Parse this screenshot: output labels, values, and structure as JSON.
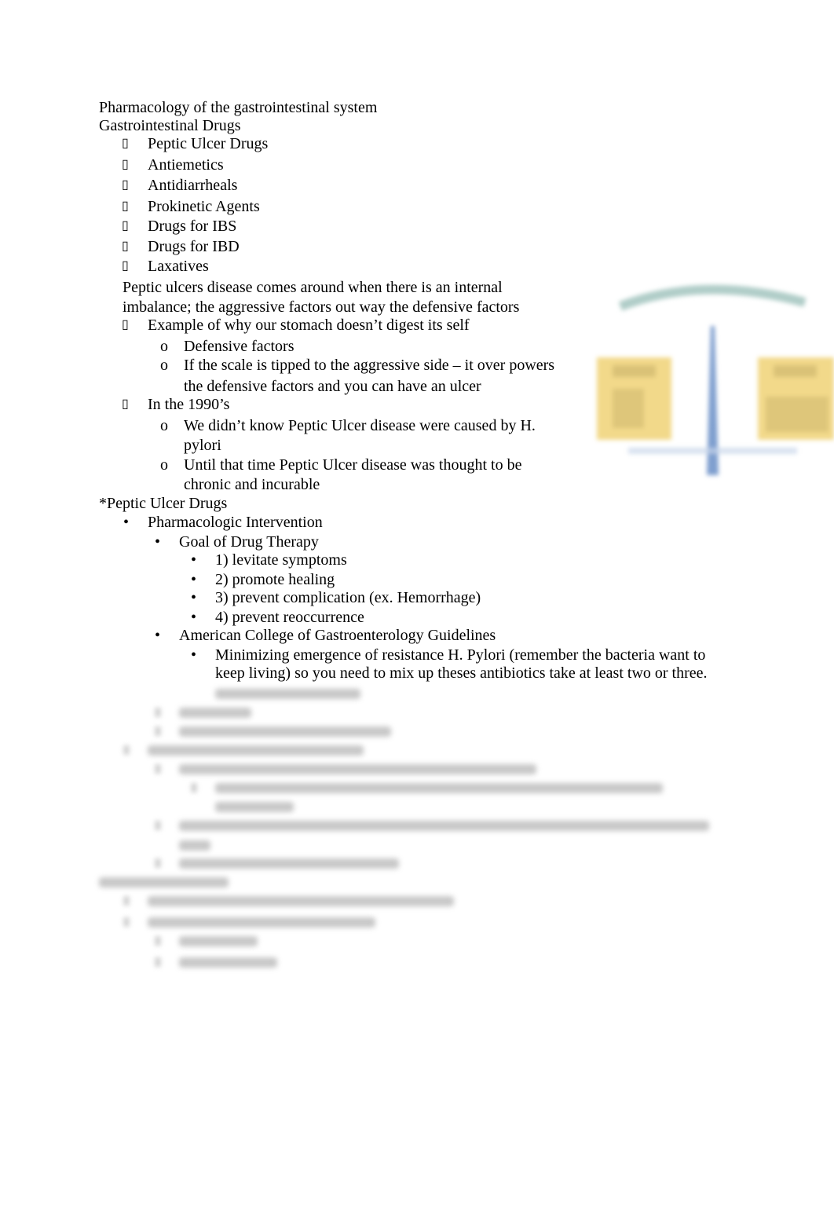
{
  "document": {
    "title": "Pharmacology of the gastrointestinal system",
    "section1": {
      "heading": "Gastrointestinal Drugs",
      "marker": "▯",
      "items": [
        "Peptic Ulcer Drugs",
        "Antiemetics",
        "Antidiarrheals",
        "Prokinetic Agents",
        "Drugs for IBS",
        "Drugs for IBD",
        "Laxatives"
      ],
      "paragraph": [
        "Peptic ulcers disease comes around when there is an internal",
        "imbalance; the aggressive factors out way the defensive factors"
      ],
      "example": "Example of why our stomach doesn’t digest its self",
      "example_sub": [
        "Defensive factors",
        "If the scale is tipped to the aggressive side – it over powers",
        "the defensive factors and you can have an ulcer"
      ],
      "nineties": "In the 1990’s",
      "nineties_sub": [
        "We didn’t know Peptic Ulcer disease were caused by H.",
        "pylori",
        "Until that time Peptic Ulcer disease was thought to be",
        "chronic and incurable"
      ],
      "sub_marker": "o"
    },
    "section2": {
      "heading": "*Peptic Ulcer Drugs",
      "bullet": "•",
      "intervention": "Pharmacologic Intervention",
      "goal": "Goal of Drug Therapy",
      "goals": [
        "1) levitate symptoms",
        "2) promote healing",
        "3) prevent complication (ex. Hemorrhage)",
        "4) prevent reoccurrence"
      ],
      "acg": "American College of Gastroenterology Guidelines",
      "acg_text": [
        "Minimizing emergence of resistance H. Pylori (remember the bacteria want to",
        "keep living) so you need to mix up theses antibiotics take at least two or three."
      ]
    },
    "figure": {
      "colors": {
        "arc": "#8fb8b0",
        "pan": "#f2d98a",
        "pole": "#7f9fcf"
      }
    }
  }
}
